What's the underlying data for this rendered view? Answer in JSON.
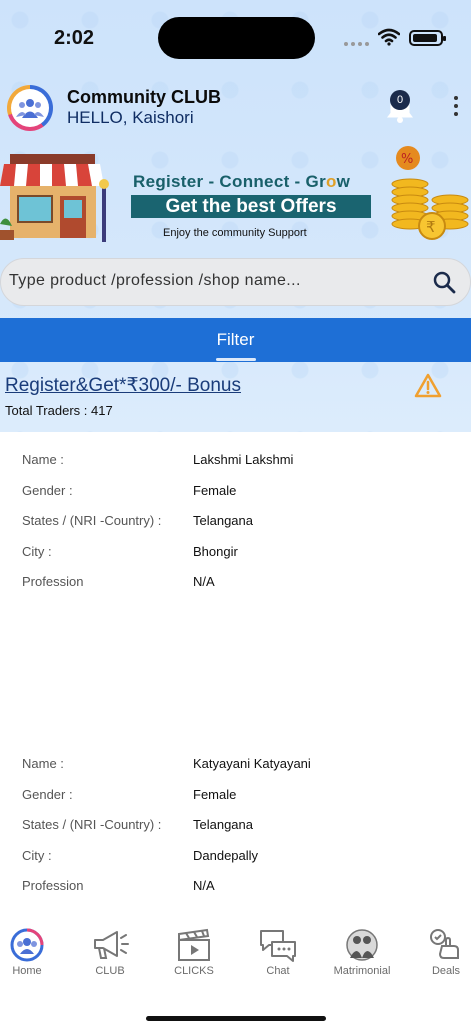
{
  "status_bar": {
    "time": "2:02"
  },
  "header": {
    "app_title": "Community CLUB",
    "greeting": "HELLO, Kaishori",
    "notification_count": "0"
  },
  "banner": {
    "line1_a": "Register - Connect  - Gr",
    "line1_o": "o",
    "line1_b": "w",
    "offer": "Get the best Offers",
    "sub": "Enjoy the community Support"
  },
  "search": {
    "placeholder": "Type product /profession /shop name..."
  },
  "filter": {
    "label": "Filter"
  },
  "promo": {
    "link": "Register&Get*₹300/- Bonus",
    "total_traders": "Total Traders : 417"
  },
  "labels": {
    "name": "Name :",
    "gender": "Gender :",
    "states": "States / (NRI -Country) :",
    "city": "City :",
    "profession": "Profession"
  },
  "traders": [
    {
      "name": "Lakshmi  Lakshmi",
      "gender": "Female",
      "state": "Telangana",
      "city": "Bhongir",
      "profession": "N/A"
    },
    {
      "name": "Katyayani  Katyayani",
      "gender": "Female",
      "state": "Telangana",
      "city": "Dandepally",
      "profession": "N/A"
    }
  ],
  "nav": {
    "home": "Home",
    "club": "CLUB",
    "clicks": "CLICKS",
    "chat": "Chat",
    "matrimonial": "Matrimonial",
    "deals": "Deals"
  },
  "colors": {
    "accent": "#1e6fd6",
    "header_bg": "#cde3fb",
    "link": "#1a3c7a",
    "warning": "#f0a030"
  }
}
